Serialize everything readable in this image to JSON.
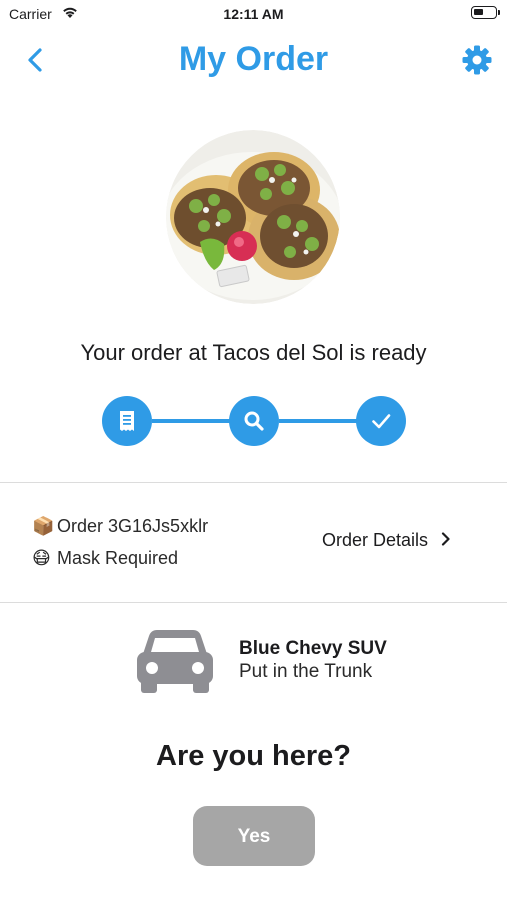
{
  "status_bar": {
    "carrier": "Carrier",
    "time": "12:11 AM"
  },
  "nav": {
    "title": "My Order",
    "back_icon": "chevron-left-icon",
    "settings_icon": "gear-icon"
  },
  "order": {
    "headline": "Your order at Tacos del Sol is ready",
    "steps": [
      {
        "icon": "receipt-icon",
        "state": "complete"
      },
      {
        "icon": "search-icon",
        "state": "complete"
      },
      {
        "icon": "checkmark-icon",
        "state": "complete"
      }
    ],
    "order_emoji": "📦",
    "order_label": "Order 3G16Js5xklr",
    "mask_emoji": "😷",
    "mask_label": "Mask Required",
    "details_link": "Order Details"
  },
  "vehicle": {
    "icon": "car-icon",
    "name": "Blue Chevy SUV",
    "instructions": "Put in the Trunk"
  },
  "arrival": {
    "question": "Are you here?",
    "yes_button": "Yes"
  },
  "colors": {
    "accent": "#2f9be6",
    "button_disabled": "#a6a6a6",
    "divider": "#dcdcdc"
  }
}
